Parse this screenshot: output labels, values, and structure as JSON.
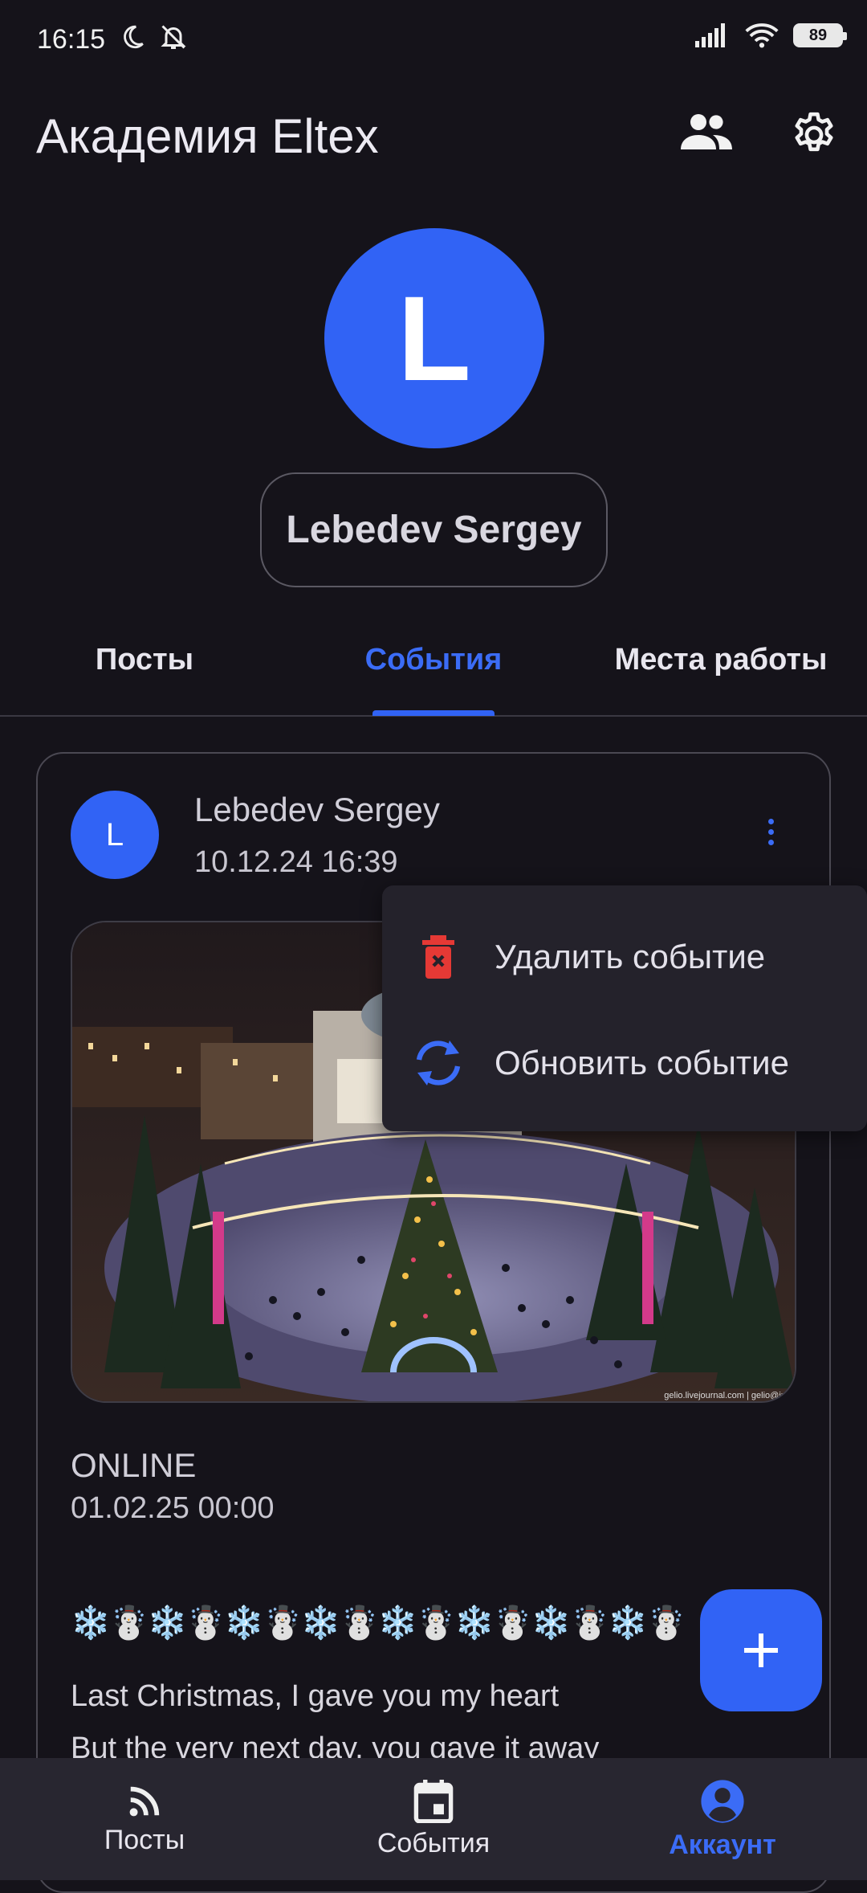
{
  "status_bar": {
    "time": "16:15",
    "battery": "89"
  },
  "header": {
    "title": "Академия Eltex"
  },
  "profile": {
    "avatar_letter": "L",
    "name": "Lebedev Sergey"
  },
  "tabs": [
    {
      "label": "Посты",
      "active": false
    },
    {
      "label": "События",
      "active": true
    },
    {
      "label": "Места работы",
      "active": false
    }
  ],
  "event": {
    "author_initial": "L",
    "author": "Lebedev Sergey",
    "published": "10.12.24 16:39",
    "photo_caption": "gelio.livejournal.com | gelio@inb",
    "type": "ONLINE",
    "event_date": "01.02.25 00:00",
    "emoji_line": "❄️☃️❄️☃️❄️☃️❄️☃️❄️☃️❄️☃️❄️☃️❄️☃️",
    "text_lines": [
      "Last Christmas, I gave you my heart",
      "But the very next day, you gave it away"
    ]
  },
  "menu": {
    "items": [
      {
        "label": "Удалить событие",
        "icon": "trash-icon",
        "color": "#e53935"
      },
      {
        "label": "Обновить событие",
        "icon": "refresh-icon",
        "color": "#3b6cf6"
      }
    ]
  },
  "bottom_nav": [
    {
      "label": "Посты",
      "icon": "rss-icon",
      "active": false
    },
    {
      "label": "События",
      "icon": "calendar-icon",
      "active": false
    },
    {
      "label": "Аккаунт",
      "icon": "account-icon",
      "active": true
    }
  ],
  "colors": {
    "accent": "#3163f5",
    "background": "#15131a",
    "danger": "#e53935"
  }
}
